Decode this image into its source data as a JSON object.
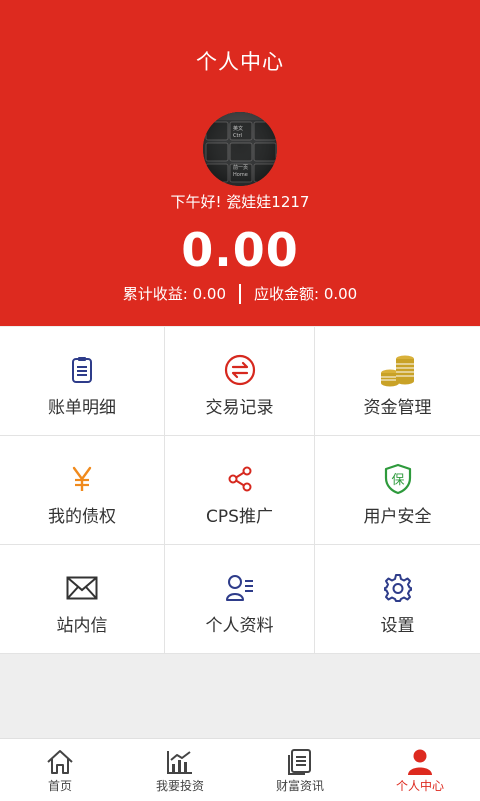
{
  "header": {
    "title": "个人中心",
    "greeting": "下午好! 瓷娃娃1217",
    "balance": "0.00",
    "accumulated_income": "累计收益: 0.00",
    "receivable_amount": "应收金额: 0.00",
    "avatar_key_texts": [
      "英文",
      "Ctrl",
      "前一页",
      "Home"
    ]
  },
  "menu": [
    {
      "label": "账单明细",
      "icon": "bill-list-icon",
      "color": "#2e3c8a"
    },
    {
      "label": "交易记录",
      "icon": "exchange-icon",
      "color": "#d6281e"
    },
    {
      "label": "资金管理",
      "icon": "coins-icon",
      "color": "#c9a227"
    },
    {
      "label": "我的债权",
      "icon": "yen-icon",
      "color": "#f08a1d"
    },
    {
      "label": "CPS推广",
      "icon": "share-icon",
      "color": "#d6281e"
    },
    {
      "label": "用户安全",
      "icon": "security-shield-icon",
      "color": "#2e9a3c",
      "icon_text": "保"
    },
    {
      "label": "站内信",
      "icon": "mail-icon",
      "color": "#333333"
    },
    {
      "label": "个人资料",
      "icon": "profile-card-icon",
      "color": "#2e3c8a"
    },
    {
      "label": "设置",
      "icon": "gear-icon",
      "color": "#2e3c8a"
    }
  ],
  "nav": [
    {
      "label": "首页",
      "icon": "home-icon",
      "active": false
    },
    {
      "label": "我要投资",
      "icon": "chart-icon",
      "active": false
    },
    {
      "label": "财富资讯",
      "icon": "document-icon",
      "active": false
    },
    {
      "label": "个人中心",
      "icon": "person-icon",
      "active": true
    }
  ],
  "colors": {
    "accent": "#dd2a1f",
    "background": "#eeeeee"
  }
}
